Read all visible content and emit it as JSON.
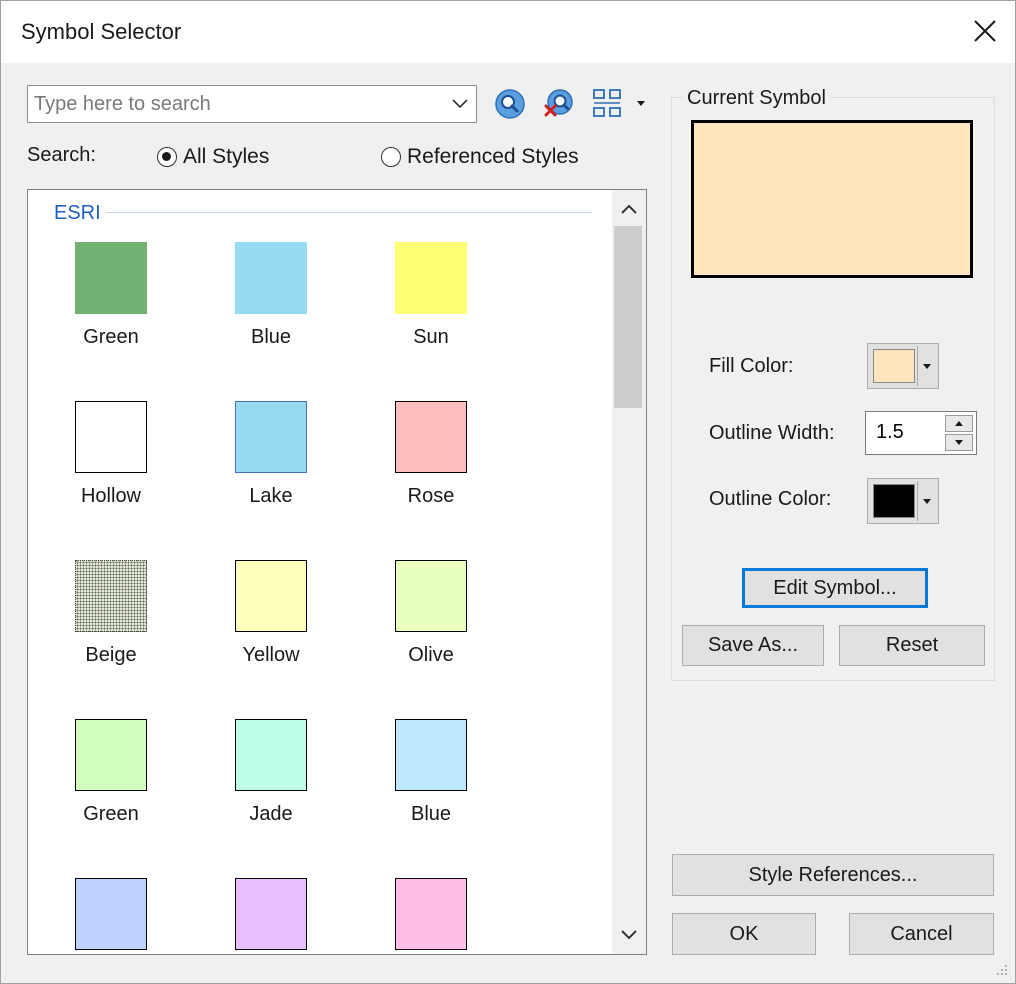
{
  "window": {
    "title": "Symbol Selector"
  },
  "search": {
    "placeholder": "Type here to search",
    "value": "",
    "scope_label": "Search:",
    "options": [
      {
        "label": "All Styles",
        "selected": true
      },
      {
        "label": "Referenced Styles",
        "selected": false
      }
    ]
  },
  "toolbar": {
    "icons": [
      "search-icon",
      "clear-search-icon",
      "view-options-icon"
    ]
  },
  "gallery": {
    "group_name": "ESRI",
    "symbols": [
      {
        "name": "Green",
        "fill": "#73b273",
        "outline": "#73b273"
      },
      {
        "name": "Blue",
        "fill": "#97dbf2",
        "outline": "#97dbf2"
      },
      {
        "name": "Sun",
        "fill": "#ffff73",
        "outline": "#ffff73"
      },
      {
        "name": "Hollow",
        "fill": "#ffffff",
        "outline": "#000000"
      },
      {
        "name": "Lake",
        "fill": "#97dbf2",
        "outline": "#4d6fbf"
      },
      {
        "name": "Rose",
        "fill": "#ffbebe",
        "outline": "#000000"
      },
      {
        "name": "Beige",
        "fill": "#e6e6d9",
        "outline": "#000000",
        "pattern": "dots"
      },
      {
        "name": "Yellow",
        "fill": "#ffffbe",
        "outline": "#000000"
      },
      {
        "name": "Olive",
        "fill": "#e9ffbe",
        "outline": "#000000"
      },
      {
        "name": "Green",
        "fill": "#d3ffbe",
        "outline": "#000000"
      },
      {
        "name": "Jade",
        "fill": "#beffe8",
        "outline": "#000000"
      },
      {
        "name": "Blue",
        "fill": "#bee8ff",
        "outline": "#000000"
      },
      {
        "name": "",
        "fill": "#bed2ff",
        "outline": "#000000"
      },
      {
        "name": "",
        "fill": "#e8beff",
        "outline": "#000000"
      },
      {
        "name": "",
        "fill": "#ffbee8",
        "outline": "#000000"
      }
    ]
  },
  "current_symbol": {
    "label": "Current Symbol",
    "preview_fill": "#ffe6be",
    "preview_outline": "#000000",
    "fill_color_label": "Fill Color:",
    "fill_color": "#ffe6be",
    "outline_width_label": "Outline Width:",
    "outline_width": "1.5",
    "outline_color_label": "Outline Color:",
    "outline_color": "#000000"
  },
  "buttons": {
    "edit_symbol": "Edit Symbol...",
    "save_as": "Save As...",
    "reset": "Reset",
    "style_references": "Style References...",
    "ok": "OK",
    "cancel": "Cancel"
  },
  "colors": {
    "accent": "#0078d7",
    "group_title": "#1f5fbf",
    "background": "#f0f0f0"
  }
}
